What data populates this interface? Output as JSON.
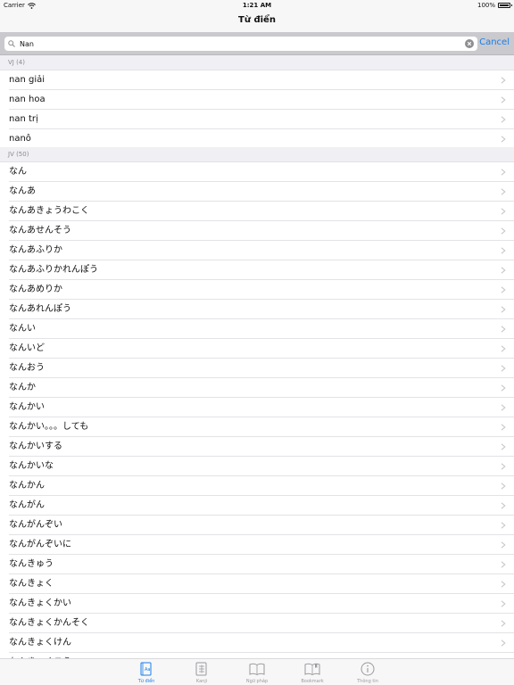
{
  "status": {
    "carrier": "Carrier",
    "time": "1:21 AM",
    "battery": "100%"
  },
  "nav": {
    "title": "Từ điển"
  },
  "search": {
    "value": "Nan",
    "cancel_label": "Cancel"
  },
  "sections": [
    {
      "header": "VJ (4)",
      "items": [
        "nan giải",
        "nan hoa",
        "nan trị",
        "nanô"
      ]
    },
    {
      "header": "JV (50)",
      "items": [
        "なん",
        "なんあ",
        "なんあきょうわこく",
        "なんあせんそう",
        "なんあふりか",
        "なんあふりかれんぽう",
        "なんあめりか",
        "なんあれんぽう",
        "なんい",
        "なんいど",
        "なんおう",
        "なんか",
        "なんかい",
        "なんかい。。。しても",
        "なんかいする",
        "なんかいな",
        "なんかん",
        "なんがん",
        "なんがんぞい",
        "なんがんぞいに",
        "なんきゅう",
        "なんきょく",
        "なんきょくかい",
        "なんきょくかんそく",
        "なんきょくけん",
        "なんきょくこう"
      ]
    }
  ],
  "tabs": [
    {
      "id": "tudien",
      "label": "Từ điển",
      "icon": "dictionary-icon",
      "active": true
    },
    {
      "id": "kanji",
      "label": "Kanji",
      "icon": "kanji-icon",
      "active": false
    },
    {
      "id": "nguphap",
      "label": "Ngữ pháp",
      "icon": "open-book-icon",
      "active": false
    },
    {
      "id": "bookmark",
      "label": "Bookmark",
      "icon": "bookmark-book-icon",
      "active": false
    },
    {
      "id": "thongtin",
      "label": "Thông tin",
      "icon": "info-icon",
      "active": false
    }
  ],
  "colors": {
    "accent": "#1a7ee8",
    "chevron": "#c7c7cc",
    "section_bg": "#efeff4"
  }
}
